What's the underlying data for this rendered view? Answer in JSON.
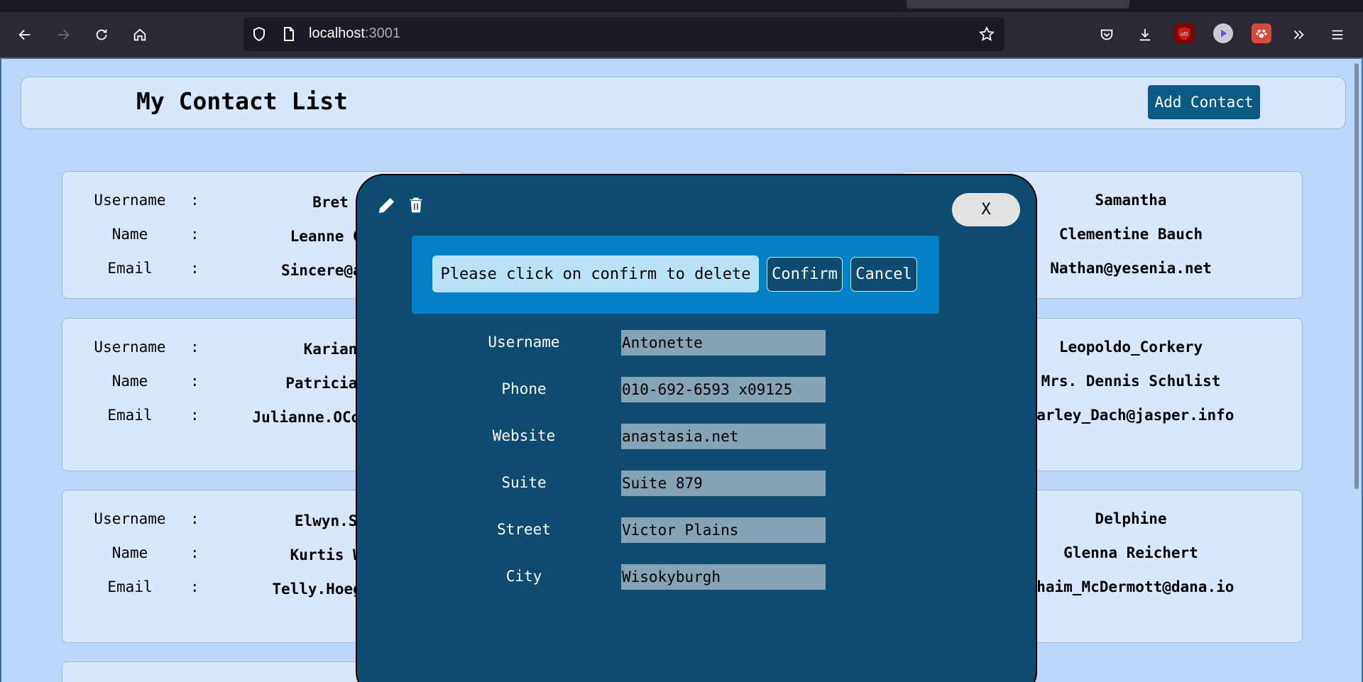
{
  "browser": {
    "url_host": "localhost",
    "url_port": ":3001"
  },
  "app": {
    "title": "My Contact List",
    "add_button": "Add Contact"
  },
  "labels": {
    "username": "Username",
    "name": "Name",
    "email": "Email",
    "colon": ":"
  },
  "contacts_left": [
    {
      "username": "Bret",
      "name": "Leanne Gr",
      "email": "Sincere@apr"
    },
    {
      "username": "Karian",
      "name": "Patricia L",
      "email": "Julianne.OConn rg"
    },
    {
      "username": "Elwyn.Sk",
      "name": "Kurtis We",
      "email": "Telly.Hoeger@"
    }
  ],
  "contacts_right": [
    {
      "username": "Samantha",
      "name": "Clementine Bauch",
      "email": "Nathan@yesenia.net"
    },
    {
      "username": "Leopoldo_Corkery",
      "name": "Mrs. Dennis Schulist",
      "email": "Karley_Dach@jasper.info"
    },
    {
      "username": "Delphine",
      "name": "Glenna Reichert",
      "email": "Chaim_McDermott@dana.io"
    }
  ],
  "modal": {
    "close_label": "X",
    "confirm_message": "Please click on confirm to delete",
    "confirm_button": "Confirm",
    "cancel_button": "Cancel",
    "fields": [
      {
        "label": "Username",
        "value": "Antonette"
      },
      {
        "label": "Phone",
        "value": "010-692-6593 x09125"
      },
      {
        "label": "Website",
        "value": "anastasia.net"
      },
      {
        "label": "Suite",
        "value": "Suite 879"
      },
      {
        "label": "Street",
        "value": "Victor Plains"
      },
      {
        "label": "City",
        "value": "Wisokyburgh"
      }
    ]
  },
  "icons": {
    "edit": "pencil-icon",
    "delete": "trash-icon"
  },
  "colors": {
    "page_bg": "#bcd7f9",
    "card_bg": "#d8e7fb",
    "modal_bg": "#0d4c70",
    "confirm_bar": "#0281c7",
    "add_button": "#0b5a85"
  }
}
